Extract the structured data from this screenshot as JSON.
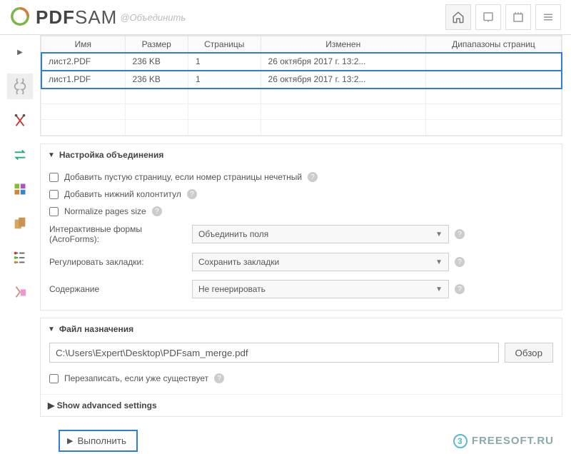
{
  "header": {
    "logo_pdf": "PDF",
    "logo_sam": "SAM",
    "subtitle": "@Объединить"
  },
  "table": {
    "cols": [
      "Имя",
      "Размер",
      "Страницы",
      "Изменен",
      "Дипапазоны страниц"
    ],
    "rows": [
      {
        "name": "лист2.PDF",
        "size": "236 KB",
        "pages": "1",
        "modified": "26 октября 2017 г. 13:2...",
        "ranges": ""
      },
      {
        "name": "лист1.PDF",
        "size": "236 KB",
        "pages": "1",
        "modified": "26 октября 2017 г. 13:2...",
        "ranges": ""
      }
    ]
  },
  "merge": {
    "title": "Настройка объединения",
    "opt1": "Добавить пустую страницу, если номер страницы нечетный",
    "opt2": "Добавить нижний колонтитул",
    "opt3": "Normalize pages size",
    "forms_label": "Интерактивные формы (AcroForms):",
    "forms_value": "Объединить поля",
    "bookmarks_label": "Регулировать закладки:",
    "bookmarks_value": "Сохранить закладки",
    "toc_label": "Содержание",
    "toc_value": "Не генерировать"
  },
  "dest": {
    "title": "Файл назначения",
    "path": "C:\\Users\\Expert\\Desktop\\PDFsam_merge.pdf",
    "browse": "Обзор",
    "overwrite": "Перезаписать, если уже существует",
    "advanced": "Show advanced settings"
  },
  "run": "Выполнить",
  "watermark": "FREESOFT.RU"
}
